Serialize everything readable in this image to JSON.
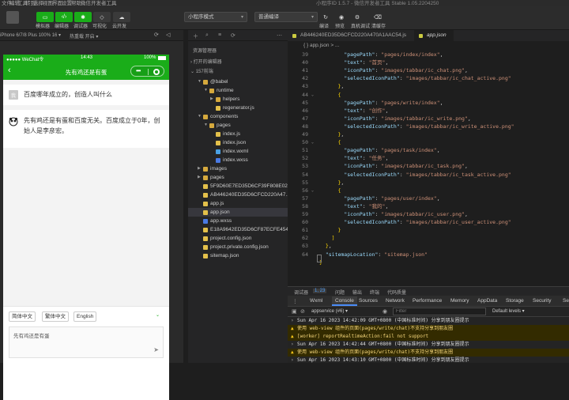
{
  "menubar": {
    "items": [
      "文件",
      "编辑",
      "工具",
      "转到",
      "选择",
      "视图",
      "界面",
      "设置",
      "帮助",
      "微信开发者工具"
    ],
    "title": "小程序ID 1.5.7 - 微信开发者工具 Stable 1.05.2204250"
  },
  "toolbar": {
    "buttons": [
      {
        "icon": "code-icon",
        "label": "模拟器"
      },
      {
        "icon": "code-icon",
        "label": "编辑器"
      },
      {
        "icon": "bug-icon",
        "label": "调试器"
      },
      {
        "icon": "visual-icon",
        "label": "可视化"
      },
      {
        "icon": "cloud-icon",
        "label": "云开发"
      }
    ],
    "mode_select": "小程序模式",
    "compile_select": "普通编译",
    "right_buttons": [
      "编译",
      "预览",
      "真机调试",
      "清缓存"
    ]
  },
  "simulator": {
    "device_bar": "iPhone 6/7/8 Plus 100% 16 ▾",
    "hotreload": "热重载 开启 ▾",
    "status": {
      "carrier": "●●●●● WeChat令",
      "time": "14:43",
      "battery": "100%"
    },
    "nav_title": "先有鸡还是有蛋",
    "messages": [
      {
        "text": "百度哪年成立的，创造人叫什么",
        "avatar": "我"
      },
      {
        "text": "先有鸡还是有蛋和百度无关。百度成立于0年，创始人是李彦宏。",
        "avatar": "AI"
      }
    ],
    "languages": [
      "简体中文",
      "繁体中文",
      "English"
    ],
    "input_value": "先有鸡还是有蛋",
    "colors": {
      "brand": "#1aad19"
    }
  },
  "explorer": {
    "title": "资源管理器",
    "sections": [
      "打开的编辑器",
      "157前端"
    ],
    "tree": [
      {
        "name": "@babel",
        "depth": 1,
        "type": "folder",
        "open": true
      },
      {
        "name": "runtime",
        "depth": 2,
        "type": "folder",
        "open": true
      },
      {
        "name": "helpers",
        "depth": 3,
        "type": "folder",
        "open": false
      },
      {
        "name": "regenerator.js",
        "depth": 3,
        "type": "js"
      },
      {
        "name": "components",
        "depth": 1,
        "type": "folder",
        "open": true
      },
      {
        "name": "pages",
        "depth": 2,
        "type": "folder",
        "open": true
      },
      {
        "name": "index.js",
        "depth": 3,
        "type": "js"
      },
      {
        "name": "index.json",
        "depth": 3,
        "type": "json"
      },
      {
        "name": "index.wxml",
        "depth": 3,
        "type": "wxml"
      },
      {
        "name": "index.wxss",
        "depth": 3,
        "type": "wxss"
      },
      {
        "name": "images",
        "depth": 1,
        "type": "folder",
        "open": false
      },
      {
        "name": "pages",
        "depth": 1,
        "type": "folder",
        "open": false
      },
      {
        "name": "5F9D60E7ED35D6CF39F808E02...",
        "depth": 1,
        "type": "js"
      },
      {
        "name": "AB446240ED35D6CFCD220A47...",
        "depth": 1,
        "type": "js"
      },
      {
        "name": "app.js",
        "depth": 1,
        "type": "js"
      },
      {
        "name": "app.json",
        "depth": 1,
        "type": "json",
        "selected": true
      },
      {
        "name": "app.wxss",
        "depth": 1,
        "type": "wxss"
      },
      {
        "name": "E18A9642ED35D6CF87ECFE454...",
        "depth": 1,
        "type": "js"
      },
      {
        "name": "project.config.json",
        "depth": 1,
        "type": "json"
      },
      {
        "name": "project.private.config.json",
        "depth": 1,
        "type": "json"
      },
      {
        "name": "sitemap.json",
        "depth": 1,
        "type": "json"
      }
    ]
  },
  "editor": {
    "tabs": [
      {
        "label": "AB446240ED35D6CFCD220A470A1AAC54.js",
        "active": false
      },
      {
        "label": "app.json",
        "active": true
      }
    ],
    "breadcrumb": "{ } app.json > ...",
    "lines": [
      {
        "no": "39",
        "fold": "",
        "html": "        <span class='k'>\"pagePath\"</span>: <span class='s'>\"pages/index/index\"</span>,"
      },
      {
        "no": "40",
        "fold": "",
        "html": "        <span class='k'>\"text\"</span>: <span class='s'>\"首页\"</span>,"
      },
      {
        "no": "41",
        "fold": "",
        "html": "        <span class='k'>\"iconPath\"</span>: <span class='s'>\"images/tabbar/ic_chat.png\"</span>,"
      },
      {
        "no": "42",
        "fold": "",
        "html": "        <span class='k'>\"selectedIconPath\"</span>: <span class='s'>\"images/tabbar/ic_chat_active.png\"</span>"
      },
      {
        "no": "43",
        "fold": "",
        "html": "      <span class='b'>}</span>,"
      },
      {
        "no": "44",
        "fold": "v",
        "html": "      <span class='b'>{</span>"
      },
      {
        "no": "45",
        "fold": "",
        "html": "        <span class='k'>\"pagePath\"</span>: <span class='s'>\"pages/write/index\"</span>,"
      },
      {
        "no": "46",
        "fold": "",
        "html": "        <span class='k'>\"text\"</span>: <span class='s'>\"创作\"</span>,"
      },
      {
        "no": "47",
        "fold": "",
        "html": "        <span class='k'>\"iconPath\"</span>: <span class='s'>\"images/tabbar/ic_write.png\"</span>,"
      },
      {
        "no": "48",
        "fold": "",
        "html": "        <span class='k'>\"selectedIconPath\"</span>: <span class='s'>\"images/tabbar/ic_write_active.png\"</span>"
      },
      {
        "no": "49",
        "fold": "",
        "html": "      <span class='b'>}</span>,"
      },
      {
        "no": "50",
        "fold": "v",
        "html": "      <span class='b'>{</span>"
      },
      {
        "no": "51",
        "fold": "",
        "html": "        <span class='k'>\"pagePath\"</span>: <span class='s'>\"pages/task/index\"</span>,"
      },
      {
        "no": "52",
        "fold": "",
        "html": "        <span class='k'>\"text\"</span>: <span class='s'>\"任务\"</span>,"
      },
      {
        "no": "53",
        "fold": "",
        "html": "        <span class='k'>\"iconPath\"</span>: <span class='s'>\"images/tabbar/ic_task.png\"</span>,"
      },
      {
        "no": "54",
        "fold": "",
        "html": "        <span class='k'>\"selectedIconPath\"</span>: <span class='s'>\"images/tabbar/ic_task_active.png\"</span>"
      },
      {
        "no": "55",
        "fold": "",
        "html": "      <span class='b'>}</span>,"
      },
      {
        "no": "56",
        "fold": "v",
        "html": "      <span class='b'>{</span>"
      },
      {
        "no": "57",
        "fold": "",
        "html": "        <span class='k'>\"pagePath\"</span>: <span class='s'>\"pages/user/index\"</span>,"
      },
      {
        "no": "58",
        "fold": "",
        "html": "        <span class='k'>\"text\"</span>: <span class='s'>\"我的\"</span>,"
      },
      {
        "no": "59",
        "fold": "",
        "html": "        <span class='k'>\"iconPath\"</span>: <span class='s'>\"images/tabbar/ic_user.png\"</span>,"
      },
      {
        "no": "60",
        "fold": "",
        "html": "        <span class='k'>\"selectedIconPath\"</span>: <span class='s'>\"images/tabbar/ic_user_active.png\"</span>"
      },
      {
        "no": "61",
        "fold": "",
        "html": "      <span class='b'>}</span>"
      },
      {
        "no": "62",
        "fold": "",
        "html": "    <span class='b'>]</span>"
      },
      {
        "no": "63",
        "fold": "",
        "html": "  <span class='b'>}</span>,"
      },
      {
        "no": "64",
        "fold": "",
        "html": "  <span class='k'>\"sitemapLocation\"</span>: <span class='s'>\"sitemap.json\"</span>"
      },
      {
        "no": "",
        "fold": "",
        "html": "<span class='b'>}</span>"
      }
    ]
  },
  "devtools": {
    "top_tabs": [
      "调试器",
      "1, 23",
      "问题",
      "输出",
      "终端",
      "代码质量"
    ],
    "tabs": [
      "Wxml",
      "Console",
      "Sources",
      "Network",
      "Performance",
      "Memory",
      "AppData",
      "Storage",
      "Security",
      "Se"
    ],
    "context": "appservice (#6)",
    "filter_placeholder": "Filter",
    "levels": "Default levels ▾",
    "console_lines": [
      {
        "type": "info",
        "text": "Sun Apr 16 2023 14:42:09 GMT+0800 (中国标准时间) 分享到朋友圈提示"
      },
      {
        "type": "warn",
        "text": "使用 web-view 组件的页面(pages/write/chat)不支持分享到朋友圈"
      },
      {
        "type": "warn",
        "text": "[worker] reportRealtimeAction:fail not support"
      },
      {
        "type": "info",
        "text": "Sun Apr 16 2023 14:42:44 GMT+0800 (中国标准时间) 分享到朋友圈提示"
      },
      {
        "type": "warn",
        "text": "使用 web-view 组件的页面(pages/write/chat)不支持分享到朋友圈"
      },
      {
        "type": "info",
        "text": "Sun Apr 16 2023 14:43:10 GMT+0800 (中国标准时间) 分享到朋友圈提示"
      }
    ]
  }
}
